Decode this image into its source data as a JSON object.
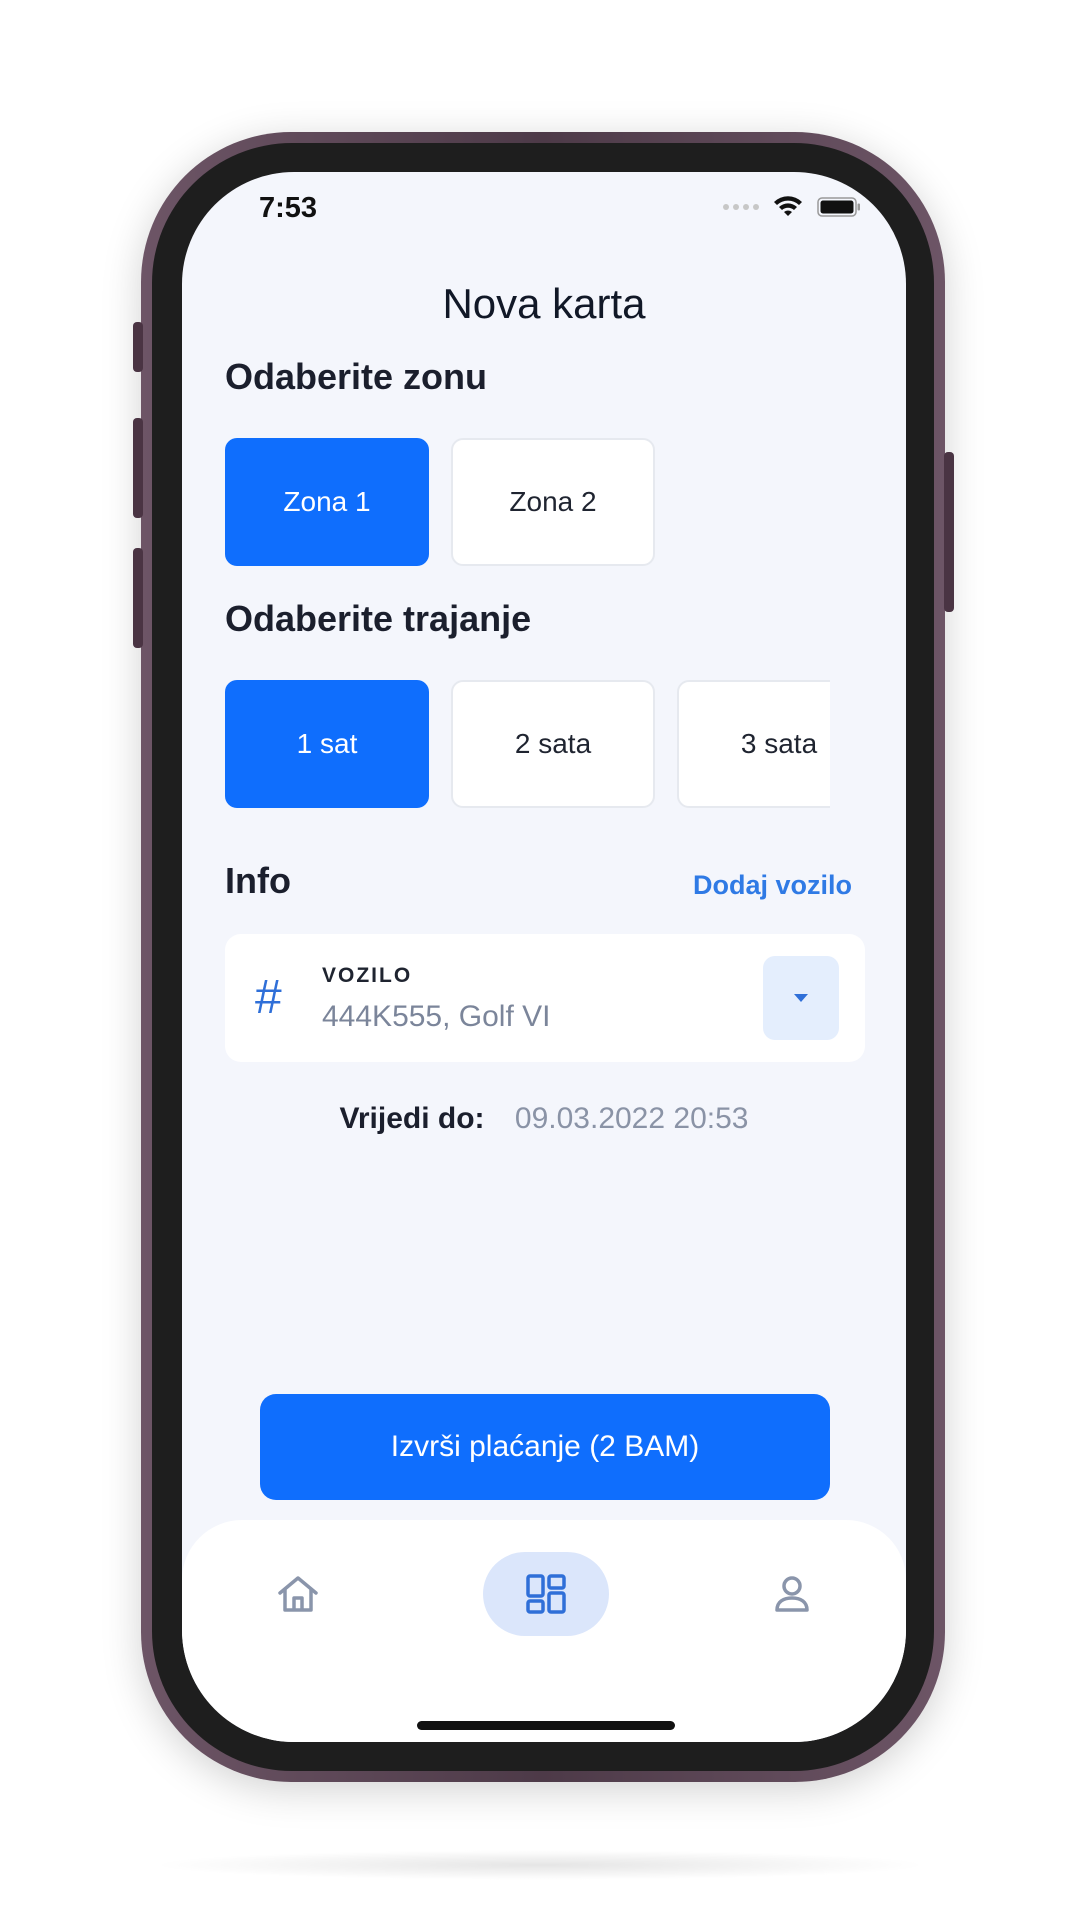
{
  "status_bar": {
    "time": "7:53"
  },
  "screen": {
    "title": "Nova karta"
  },
  "zone_section": {
    "heading": "Odaberite zonu",
    "options": [
      {
        "label": "Zona 1",
        "selected": true
      },
      {
        "label": "Zona 2",
        "selected": false
      }
    ]
  },
  "duration_section": {
    "heading": "Odaberite trajanje",
    "options": [
      {
        "label": "1 sat",
        "selected": true
      },
      {
        "label": "2 sata",
        "selected": false
      },
      {
        "label": "3 sata",
        "selected": false
      }
    ]
  },
  "info_section": {
    "heading": "Info",
    "add_vehicle_link": "Dodaj vozilo",
    "vehicle": {
      "icon": "hash-icon",
      "label": "VOZILO",
      "value": "444K555, Golf VI",
      "dropdown_icon": "caret-down-icon"
    },
    "valid_until_label": "Vrijedi do:",
    "valid_until_value": "09.03.2022 20:53"
  },
  "pay_button": {
    "label": "Izvrši plaćanje (2 BAM)"
  },
  "bottom_nav": {
    "items": [
      {
        "name": "home",
        "icon": "home-icon",
        "active": false
      },
      {
        "name": "tickets",
        "icon": "dashboard-icon",
        "active": true
      },
      {
        "name": "profile",
        "icon": "user-icon",
        "active": false
      }
    ]
  },
  "colors": {
    "primary": "#0f6efd",
    "link": "#2f7ae5",
    "screen_background": "#f4f6fc",
    "nav_active_pill": "#dbe6fb",
    "frame": "#5c4455"
  }
}
